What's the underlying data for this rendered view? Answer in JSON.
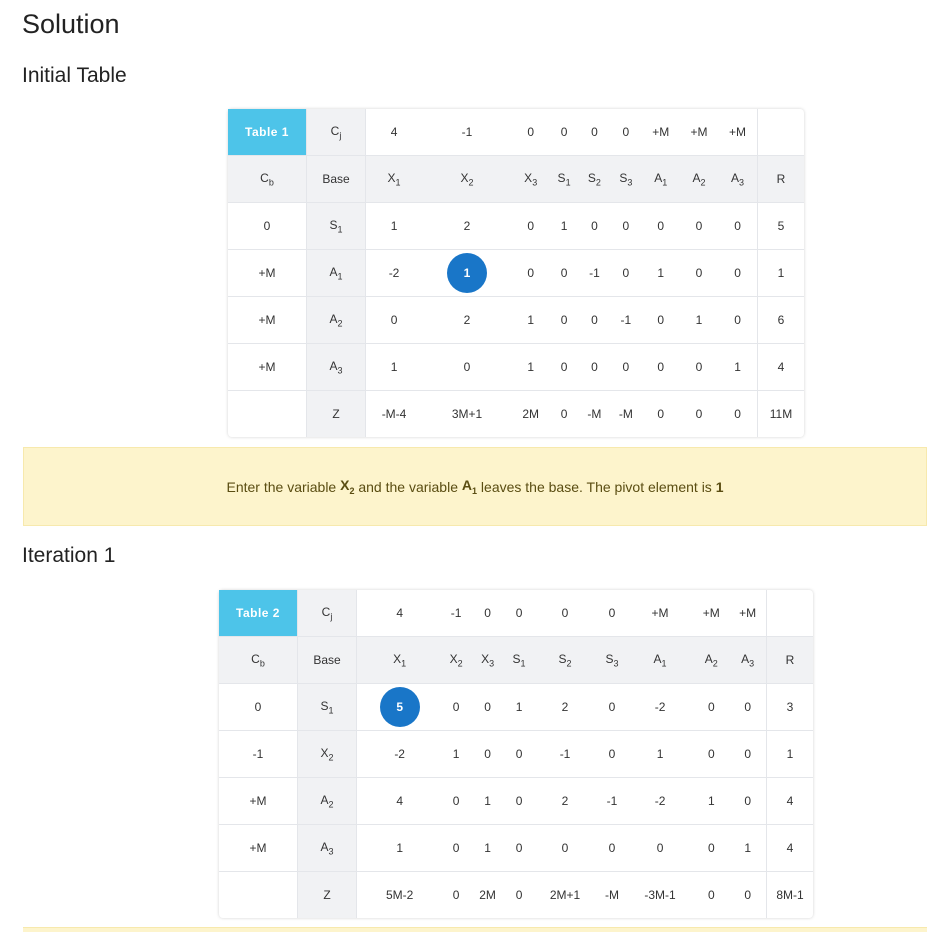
{
  "solution_title": "Solution",
  "section1_title": "Initial Table",
  "section2_title": "Iteration 1",
  "table1": {
    "name": "Table 1",
    "cj_label": "C",
    "cj_sub": "j",
    "cj": [
      "4",
      "-1",
      "0",
      "0",
      "0",
      "0",
      "+M",
      "+M",
      "+M"
    ],
    "cb_label": "C",
    "cb_sub": "b",
    "base_label": "Base",
    "cols": [
      {
        "n": "X",
        "s": "1"
      },
      {
        "n": "X",
        "s": "2"
      },
      {
        "n": "X",
        "s": "3"
      },
      {
        "n": "S",
        "s": "1"
      },
      {
        "n": "S",
        "s": "2"
      },
      {
        "n": "S",
        "s": "3"
      },
      {
        "n": "A",
        "s": "1"
      },
      {
        "n": "A",
        "s": "2"
      },
      {
        "n": "A",
        "s": "3"
      }
    ],
    "r_label": "R",
    "rows": [
      {
        "cb": "0",
        "bn": "S",
        "bs": "1",
        "v": [
          "1",
          "2",
          "0",
          "1",
          "0",
          "0",
          "0",
          "0",
          "0"
        ],
        "r": "5"
      },
      {
        "cb": "+M",
        "bn": "A",
        "bs": "1",
        "v": [
          "-2",
          "1",
          "0",
          "0",
          "-1",
          "0",
          "1",
          "0",
          "0"
        ],
        "r": "1"
      },
      {
        "cb": "+M",
        "bn": "A",
        "bs": "2",
        "v": [
          "0",
          "2",
          "1",
          "0",
          "0",
          "-1",
          "0",
          "1",
          "0"
        ],
        "r": "6"
      },
      {
        "cb": "+M",
        "bn": "A",
        "bs": "3",
        "v": [
          "1",
          "0",
          "1",
          "0",
          "0",
          "0",
          "0",
          "0",
          "1"
        ],
        "r": "4"
      }
    ],
    "z_label": "Z",
    "z": [
      "-M-4",
      "3M+1",
      "2M",
      "0",
      "-M",
      "-M",
      "0",
      "0",
      "0"
    ],
    "z_r": "11M",
    "pivot": {
      "row": 1,
      "col": 1
    }
  },
  "notice": {
    "p1": "Enter the variable ",
    "enter_var": "X",
    "enter_sub": "2",
    "p2": " and the variable ",
    "leave_var": "A",
    "leave_sub": "1",
    "p3": " leaves the base. The pivot element is ",
    "pivot_value": "1"
  },
  "table2": {
    "name": "Table 2",
    "cj_label": "C",
    "cj_sub": "j",
    "cj": [
      "4",
      "-1",
      "0",
      "0",
      "0",
      "0",
      "+M",
      "+M",
      "+M"
    ],
    "cb_label": "C",
    "cb_sub": "b",
    "base_label": "Base",
    "cols": [
      {
        "n": "X",
        "s": "1"
      },
      {
        "n": "X",
        "s": "2"
      },
      {
        "n": "X",
        "s": "3"
      },
      {
        "n": "S",
        "s": "1"
      },
      {
        "n": "S",
        "s": "2"
      },
      {
        "n": "S",
        "s": "3"
      },
      {
        "n": "A",
        "s": "1"
      },
      {
        "n": "A",
        "s": "2"
      },
      {
        "n": "A",
        "s": "3"
      }
    ],
    "r_label": "R",
    "rows": [
      {
        "cb": "0",
        "bn": "S",
        "bs": "1",
        "v": [
          "5",
          "0",
          "0",
          "1",
          "2",
          "0",
          "-2",
          "0",
          "0"
        ],
        "r": "3"
      },
      {
        "cb": "-1",
        "bn": "X",
        "bs": "2",
        "v": [
          "-2",
          "1",
          "0",
          "0",
          "-1",
          "0",
          "1",
          "0",
          "0"
        ],
        "r": "1"
      },
      {
        "cb": "+M",
        "bn": "A",
        "bs": "2",
        "v": [
          "4",
          "0",
          "1",
          "0",
          "2",
          "-1",
          "-2",
          "1",
          "0"
        ],
        "r": "4"
      },
      {
        "cb": "+M",
        "bn": "A",
        "bs": "3",
        "v": [
          "1",
          "0",
          "1",
          "0",
          "0",
          "0",
          "0",
          "0",
          "1"
        ],
        "r": "4"
      }
    ],
    "z_label": "Z",
    "z": [
      "5M-2",
      "0",
      "2M",
      "0",
      "2M+1",
      "-M",
      "-3M-1",
      "0",
      "0"
    ],
    "z_r": "8M-1",
    "pivot": {
      "row": 0,
      "col": 0
    }
  },
  "colors": {
    "header_blue": "#4dc4e9",
    "pivot_blue": "#1976c8",
    "notice_bg": "#fdf4cc"
  }
}
